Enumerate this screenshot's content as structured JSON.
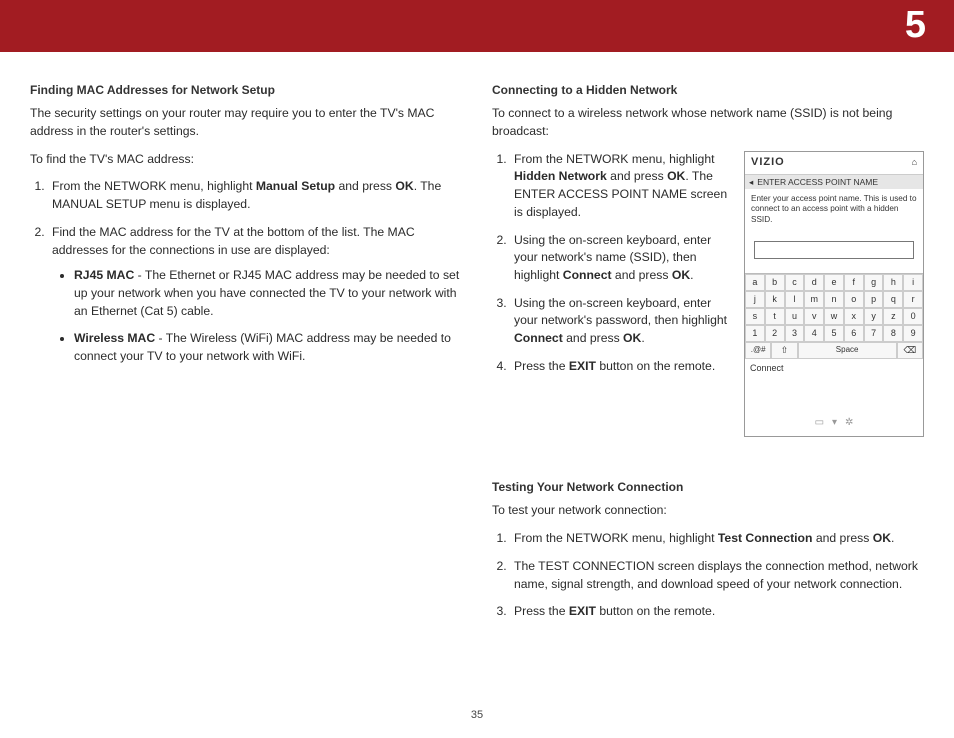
{
  "chapter": "5",
  "page_number": "35",
  "left": {
    "title": "Finding MAC Addresses for Network Setup",
    "intro": "The security settings on your router may require you to enter the TV's MAC address in the router's settings.",
    "lead": "To find the TV's MAC address:",
    "step1_a": "From the NETWORK menu, highlight ",
    "step1_b": "Manual Setup",
    "step1_c": " and press ",
    "step1_d": "OK",
    "step1_e": ". The MANUAL SETUP menu is displayed.",
    "step2": "Find the MAC address for the TV at the bottom of the list. The MAC addresses for the connections in use are displayed:",
    "bullet1_a": "RJ45 MAC",
    "bullet1_b": " - The Ethernet or RJ45 MAC address may be needed to set up your network when you have connected the TV to your network with an Ethernet (Cat 5) cable.",
    "bullet2_a": "Wireless MAC",
    "bullet2_b": " - The Wireless (WiFi) MAC address may be needed to connect your TV to your network with WiFi."
  },
  "right_top": {
    "title": "Connecting to a Hidden Network",
    "intro": "To connect to a wireless network whose network name (SSID) is not being broadcast:",
    "s1_a": "From the NETWORK menu, highlight ",
    "s1_b": "Hidden Network",
    "s1_c": " and press ",
    "s1_d": "OK",
    "s1_e": ". The ENTER ACCESS POINT NAME screen is displayed.",
    "s2_a": "Using the on-screen keyboard, enter your network's name (SSID), then highlight ",
    "s2_b": "Connect",
    "s2_c": " and press ",
    "s2_d": "OK",
    "s2_e": ".",
    "s3_a": "Using the on-screen keyboard, enter your network's password, then highlight ",
    "s3_b": "Connect",
    "s3_c": " and press ",
    "s3_d": "OK",
    "s3_e": ".",
    "s4_a": "Press the ",
    "s4_b": "EXIT",
    "s4_c": " button on the remote."
  },
  "ui": {
    "brand": "VIZIO",
    "home_icon": "⌂",
    "back_icon": "◂",
    "title": "ENTER ACCESS POINT NAME",
    "help": "Enter your access point name. This is used to connect to an access point with a hidden SSID.",
    "rows": [
      [
        "a",
        "b",
        "c",
        "d",
        "e",
        "f",
        "g",
        "h",
        "i"
      ],
      [
        "j",
        "k",
        "l",
        "m",
        "n",
        "o",
        "p",
        "q",
        "r"
      ],
      [
        "s",
        "t",
        "u",
        "v",
        "w",
        "x",
        "y",
        "z",
        "0"
      ],
      [
        "1",
        "2",
        "3",
        "4",
        "5",
        "6",
        "7",
        "8",
        "9"
      ]
    ],
    "sym": ".@#",
    "shift": "⇧",
    "space": "Space",
    "del": "⌫",
    "connect": "Connect",
    "f1": "▭",
    "f2": "▾",
    "f3": "✲"
  },
  "right_bottom": {
    "title": "Testing Your Network Connection",
    "intro": "To test your network connection:",
    "s1_a": "From the NETWORK menu, highlight ",
    "s1_b": "Test Connection",
    "s1_c": " and press ",
    "s1_d": "OK",
    "s1_e": ".",
    "s2": "The TEST CONNECTION screen displays the connection method, network name, signal strength, and download speed of your network connection.",
    "s3_a": "Press the ",
    "s3_b": "EXIT",
    "s3_c": " button on the remote."
  }
}
